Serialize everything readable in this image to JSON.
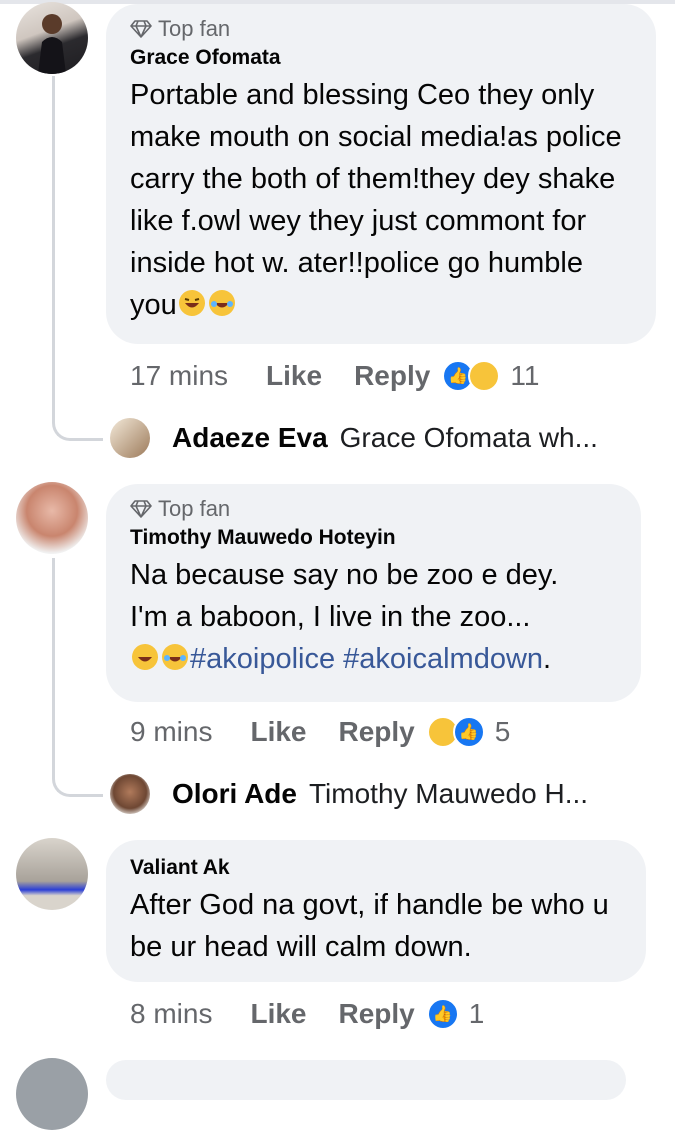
{
  "comments": [
    {
      "badge": "Top fan",
      "author": "Grace Ofomata",
      "text": "Portable and blessing Ceo they only make mouth on social media!as police carry the both of them!they dey shake like f.owl wey they just commont for inside hot w. ater!!police go humble you",
      "time": "17 mins",
      "like_label": "Like",
      "reply_label": "Reply",
      "reaction_count": "11",
      "reply": {
        "name": "Adaeze Eva",
        "text": "Grace Ofomata wh..."
      }
    },
    {
      "badge": "Top fan",
      "author": "Timothy Mauwedo Hoteyin",
      "text1": "Na because say no be zoo e dey.",
      "text2": "I'm a baboon, I live in the zoo...",
      "hashtags": "#akoipolice #akoicalmdown",
      "punct": ".",
      "time": "9 mins",
      "like_label": "Like",
      "reply_label": "Reply",
      "reaction_count": "5",
      "reply": {
        "name": "Olori Ade",
        "text": "Timothy Mauwedo H..."
      }
    },
    {
      "author": "Valiant Ak",
      "text": "After God na govt, if handle be who u be ur head will calm down.",
      "time": "8 mins",
      "like_label": "Like",
      "reply_label": "Reply",
      "reaction_count": "1"
    }
  ],
  "colors": {
    "bubble": "#f0f2f5",
    "like_blue": "#1877f2",
    "hashtag": "#385898",
    "meta_gray": "#65676b"
  },
  "icons": [
    "diamond-icon",
    "like-reaction-icon",
    "haha-reaction-icon",
    "laughing-emoji-icon"
  ]
}
